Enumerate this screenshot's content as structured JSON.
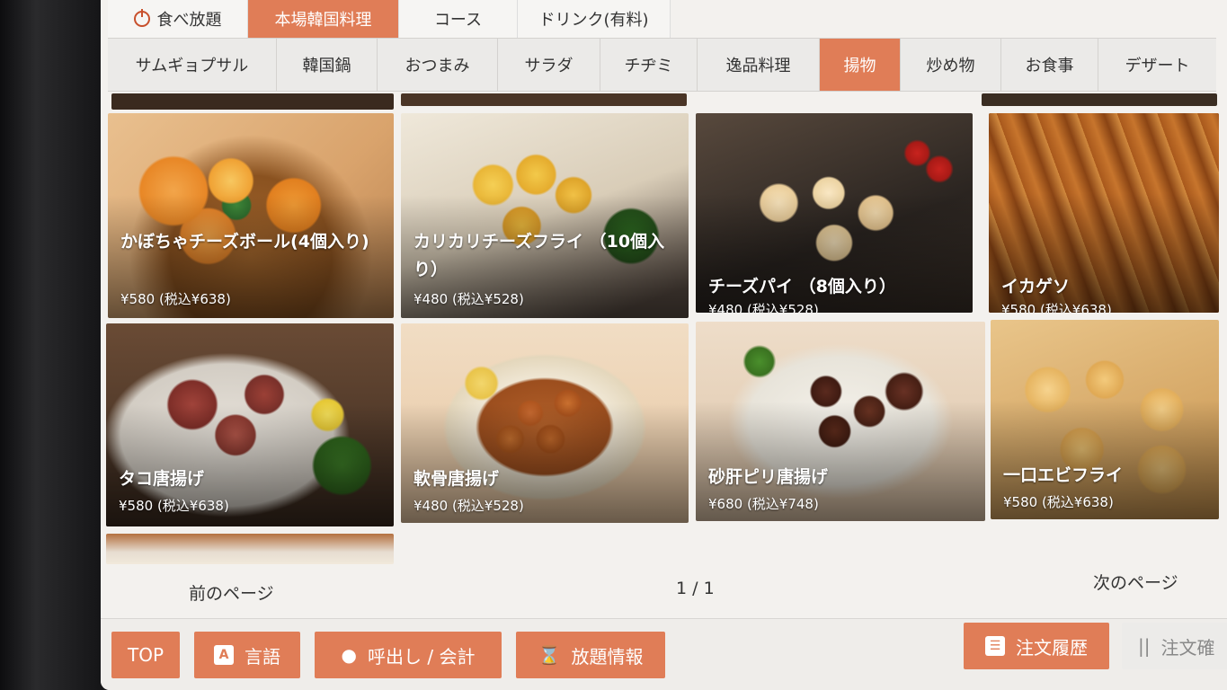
{
  "top_tabs": [
    "食べ放題",
    "本場韓国料理",
    "コース",
    "ドリンク(有料)"
  ],
  "categories": [
    {
      "label": "サムギョプサル"
    },
    {
      "label": "韓国鍋"
    },
    {
      "label": "おつまみ"
    },
    {
      "label": "サラダ"
    },
    {
      "label": "チヂミ"
    },
    {
      "label": "逸品料理"
    },
    {
      "label": "揚物",
      "active": true
    },
    {
      "label": "炒め物"
    },
    {
      "label": "お食事"
    },
    {
      "label": "デザート"
    }
  ],
  "items": [
    {
      "name": "かぼちゃチーズボール(4個入り)",
      "price": "¥580 (税込¥638)"
    },
    {
      "name": "カリカリチーズフライ （10個入り）",
      "price": "¥480 (税込¥528)"
    },
    {
      "name": "チーズパイ （8個入り）",
      "price": "¥480 (税込¥528)"
    },
    {
      "name": "イカゲソ",
      "price": "¥580 (税込¥638)"
    },
    {
      "name": "タコ唐揚げ",
      "price": "¥580 (税込¥638)"
    },
    {
      "name": "軟骨唐揚げ",
      "price": "¥480 (税込¥528)"
    },
    {
      "name": "砂肝ピリ唐揚げ",
      "price": "¥680 (税込¥748)"
    },
    {
      "name": "一口エビフライ",
      "price": "¥580 (税込¥638)"
    }
  ],
  "pager": {
    "prev": "前のページ",
    "indicator": "1 / 1",
    "next": "次のページ"
  },
  "bottom": {
    "top": "TOP",
    "language": "言語",
    "call": "呼出し / 会計",
    "plan_info": "放題情報",
    "history": "注文履歴",
    "confirm": "注文確"
  },
  "colors": {
    "accent": "#e07d57"
  }
}
